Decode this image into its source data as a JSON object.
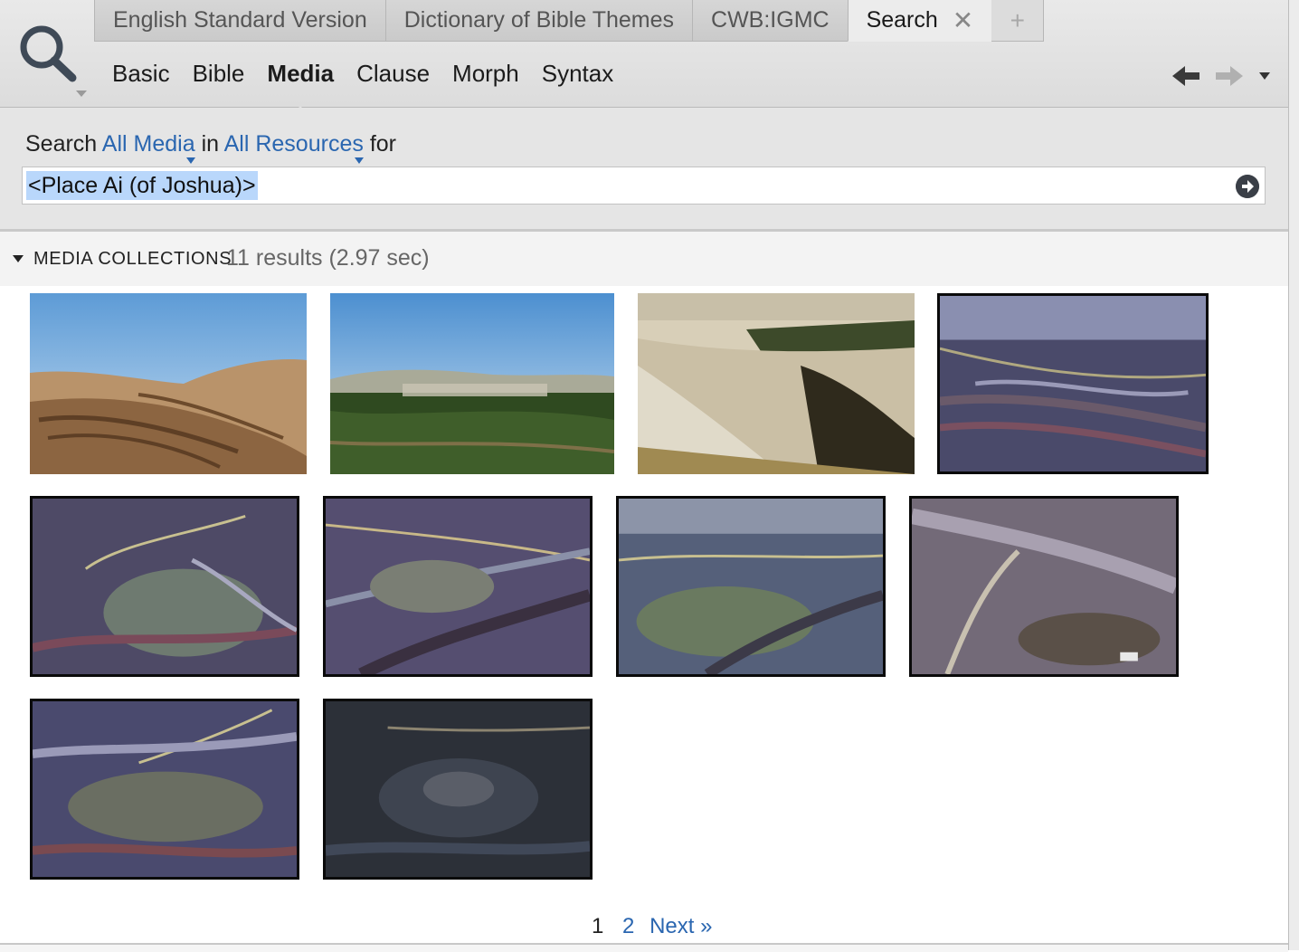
{
  "tabs": [
    {
      "label": "English Standard Version",
      "active": false
    },
    {
      "label": "Dictionary of Bible Themes",
      "active": false
    },
    {
      "label": "CWB:IGMC",
      "active": false
    },
    {
      "label": "Search",
      "active": true,
      "close": "✕"
    }
  ],
  "tab_add": "+",
  "search_modes": [
    "Basic",
    "Bible",
    "Media",
    "Clause",
    "Morph",
    "Syntax"
  ],
  "active_mode": "Media",
  "search": {
    "prefix": "Search",
    "scope_link": "All Media",
    "in_text": "in",
    "resource_link": "All Resources",
    "for_text": "for",
    "query": "<Place Ai (of Joshua)>"
  },
  "results": {
    "collection_title": "MEDIA COLLECTIONS",
    "count_text": "11 results (2.97 sec)"
  },
  "thumbnails": [
    {
      "id": "t1",
      "kind": "photo-desert-hills"
    },
    {
      "id": "t2",
      "kind": "photo-green-hillside-village"
    },
    {
      "id": "t3",
      "kind": "photo-stone-ruins"
    },
    {
      "id": "t4",
      "kind": "aerial-photo"
    },
    {
      "id": "t5",
      "kind": "aerial-photo"
    },
    {
      "id": "t6",
      "kind": "aerial-photo"
    },
    {
      "id": "t7",
      "kind": "aerial-photo"
    },
    {
      "id": "t8",
      "kind": "aerial-photo"
    },
    {
      "id": "t9",
      "kind": "aerial-photo"
    },
    {
      "id": "t10",
      "kind": "aerial-photo-dark"
    }
  ],
  "pager": {
    "current": "1",
    "page2": "2",
    "next": "Next »"
  },
  "colors": {
    "link": "#2a66b0",
    "selection": "#b9d7fb"
  }
}
